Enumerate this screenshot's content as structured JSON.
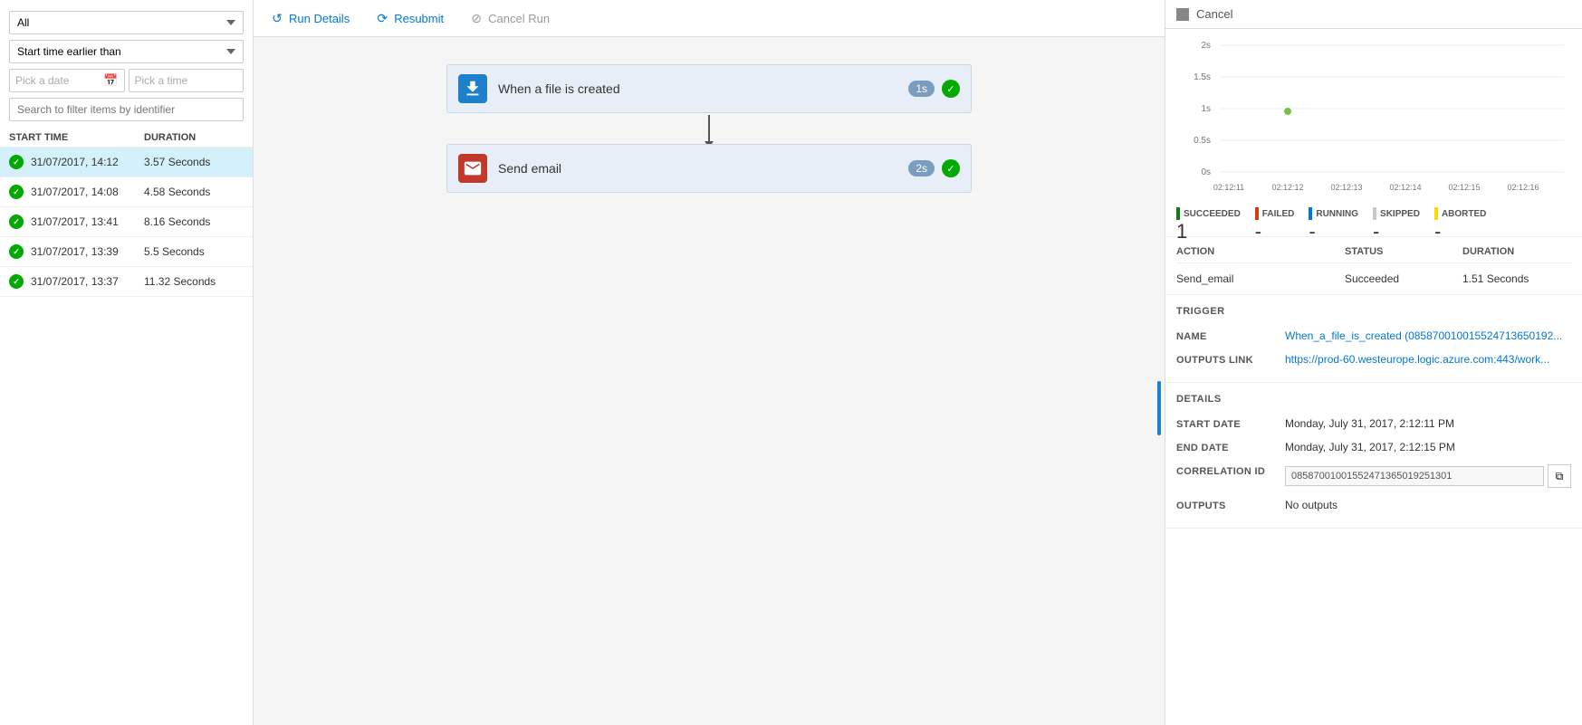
{
  "leftPanel": {
    "filter": {
      "allOption": "All",
      "timeFilter": "Start time earlier than",
      "datePlaceholder": "Pick a date",
      "timePlaceholder": "Pick a time",
      "searchPlaceholder": "Search to filter items by identifier"
    },
    "listHeaders": {
      "startTime": "START TIME",
      "duration": "DURATION"
    },
    "runs": [
      {
        "time": "31/07/2017, 14:12",
        "duration": "3.57 Seconds",
        "selected": true
      },
      {
        "time": "31/07/2017, 14:08",
        "duration": "4.58 Seconds",
        "selected": false
      },
      {
        "time": "31/07/2017, 13:41",
        "duration": "8.16 Seconds",
        "selected": false
      },
      {
        "time": "31/07/2017, 13:39",
        "duration": "5.5 Seconds",
        "selected": false
      },
      {
        "time": "31/07/2017, 13:37",
        "duration": "11.32 Seconds",
        "selected": false
      }
    ]
  },
  "toolbar": {
    "runDetails": "Run Details",
    "resubmit": "Resubmit",
    "cancelRun": "Cancel Run"
  },
  "flow": {
    "steps": [
      {
        "label": "When a file is created",
        "duration": "1s",
        "iconType": "cloud",
        "succeeded": true
      },
      {
        "label": "Send email",
        "duration": "2s",
        "iconType": "email",
        "succeeded": true
      }
    ]
  },
  "rightPanel": {
    "cancelLabel": "Cancel",
    "chart": {
      "yLabels": [
        "2s",
        "1.5s",
        "1s",
        "0.5s",
        "0s"
      ],
      "xLabels": [
        "02:12:11",
        "02:12:12",
        "02:12:13",
        "02:12:14",
        "02:12:15",
        "02:12:16"
      ],
      "dotX": 65,
      "dotY": 88
    },
    "legend": [
      {
        "label": "SUCCEEDED",
        "color": "#107c10",
        "value": "1"
      },
      {
        "label": "FAILED",
        "color": "#d83b01",
        "value": "-"
      },
      {
        "label": "RUNNING",
        "color": "#0078d4",
        "value": "-"
      },
      {
        "label": "SKIPPED",
        "color": "#c8c8c8",
        "value": "-"
      },
      {
        "label": "ABORTED",
        "color": "#ffd700",
        "value": "-"
      }
    ],
    "actionTable": {
      "headers": {
        "action": "ACTION",
        "status": "STATUS",
        "duration": "DURATION"
      },
      "rows": [
        {
          "action": "Send_email",
          "status": "Succeeded",
          "duration": "1.51 Seconds"
        }
      ]
    },
    "trigger": {
      "title": "TRIGGER",
      "name": {
        "label": "NAME",
        "value": "When_a_file_is_created (085870010015524713650192..."
      },
      "outputsLink": {
        "label": "OUTPUTS LINK",
        "value": "https://prod-60.westeurope.logic.azure.com:443/work..."
      }
    },
    "details": {
      "title": "DETAILS",
      "startDate": {
        "label": "START DATE",
        "value": "Monday, July 31, 2017, 2:12:11 PM"
      },
      "endDate": {
        "label": "END DATE",
        "value": "Monday, July 31, 2017, 2:12:15 PM"
      },
      "correlationId": {
        "label": "CORRELATION ID",
        "value": "08587001001552471365019251301"
      },
      "outputs": {
        "label": "OUTPUTS",
        "value": "No outputs"
      }
    }
  }
}
